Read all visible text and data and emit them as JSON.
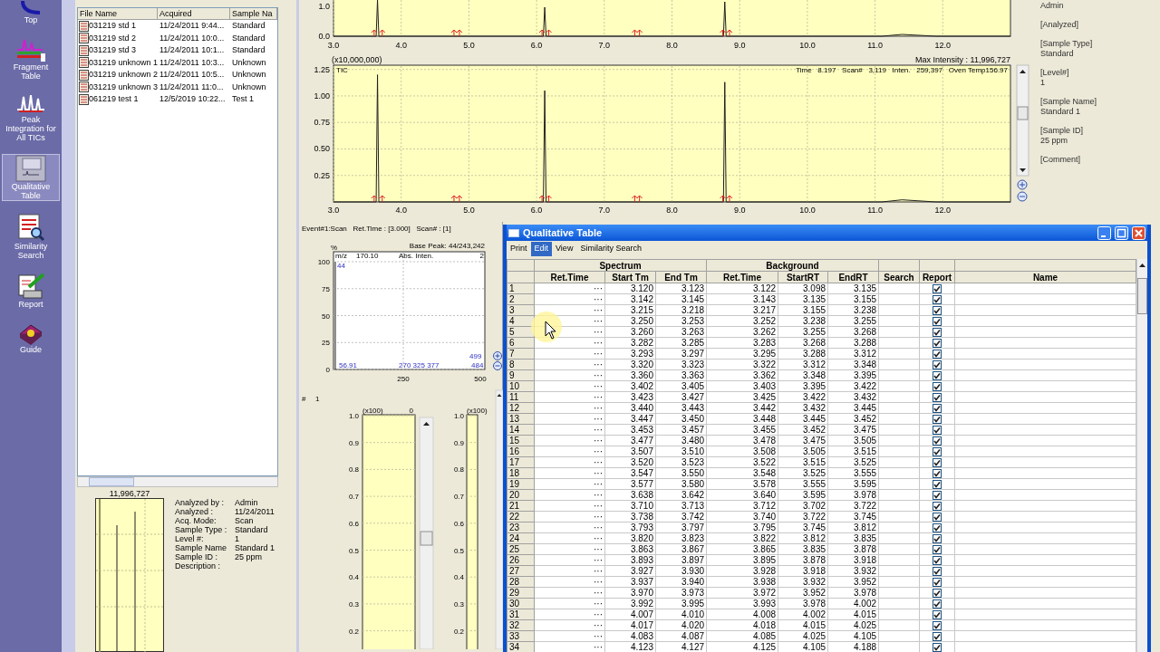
{
  "sidebar": {
    "items": [
      {
        "label": "Top",
        "selected": false
      },
      {
        "label": "Fragment Table",
        "selected": false
      },
      {
        "label": "Peak Integration for All TICs",
        "selected": false
      },
      {
        "label": "Qualitative Table",
        "selected": true
      },
      {
        "label": "Similarity Search",
        "selected": false
      },
      {
        "label": "Report",
        "selected": false
      },
      {
        "label": "Guide",
        "selected": false
      }
    ]
  },
  "file_list": {
    "columns": [
      "File Name",
      "Acquired",
      "Sample Na"
    ],
    "rows": [
      [
        "031219 std 1",
        "11/24/2011 9:44...",
        "Standard"
      ],
      [
        "031219 std 2",
        "11/24/2011 10:0...",
        "Standard"
      ],
      [
        "031219 std 3",
        "11/24/2011 10:1...",
        "Standard"
      ],
      [
        "031219 unknown 1",
        "11/24/2011 10:3...",
        "Unknown"
      ],
      [
        "031219 unknown 2",
        "11/24/2011 10:5...",
        "Unknown"
      ],
      [
        "031219 unknown 3",
        "11/24/2011 11:0...",
        "Unknown"
      ],
      [
        "061219 test 1",
        "12/5/2019 10:22...",
        "Test 1"
      ]
    ]
  },
  "info_panel": {
    "max_intensity": "11,996,727",
    "fields": [
      {
        "label": "Analyzed by :",
        "value": "Admin"
      },
      {
        "label": "Analyzed :",
        "value": "11/24/2011"
      },
      {
        "label": "Acq. Mode:",
        "value": "Scan"
      },
      {
        "label": "Sample Type :",
        "value": "Standard"
      },
      {
        "label": "Level #:",
        "value": "1"
      },
      {
        "label": "Sample Name",
        "value": "Standard 1"
      },
      {
        "label": "Sample ID :",
        "value": "25 ppm"
      },
      {
        "label": "Description :"
      }
    ]
  },
  "chromatogram_top": {
    "y_ticks": [
      "1.0",
      "0.0"
    ],
    "x_ticks": [
      "3.0",
      "4.0",
      "5.0",
      "6.0",
      "7.0",
      "8.0",
      "9.0",
      "10.0",
      "11.0",
      "12.0"
    ]
  },
  "chromatogram_main": {
    "scale": "(x10,000,000)",
    "max_intensity": "Max Intensity : 11,996,727",
    "readout": [
      "Time",
      "8.197",
      "Scan#",
      "3,119",
      "Inten.",
      "259,397",
      "Oven Temp156.97"
    ],
    "chart_data": {
      "type": "line",
      "x": [
        3.0,
        3.63,
        3.65,
        3.67,
        6.1,
        6.12,
        6.14,
        8.76,
        8.78,
        8.8,
        11.1,
        11.4,
        11.9,
        13.0
      ],
      "series": [
        {
          "name": "TIC",
          "color": "#202020",
          "values": [
            0,
            0,
            1.2,
            0,
            0,
            1.05,
            0,
            0,
            1.13,
            0,
            0,
            0.02,
            0,
            0
          ]
        }
      ],
      "xlim": [
        3,
        13
      ],
      "ylim": [
        0,
        1.29
      ],
      "grid": true,
      "xticks": [
        {
          "value": 3,
          "label": "3.0"
        },
        {
          "value": 4,
          "label": "4.0"
        },
        {
          "value": 5,
          "label": "5.0"
        },
        {
          "value": 6,
          "label": "6.0"
        },
        {
          "value": 7,
          "label": "7.0"
        },
        {
          "value": 8,
          "label": "8.0"
        },
        {
          "value": 9,
          "label": "9.0"
        },
        {
          "value": 10,
          "label": "10.0"
        },
        {
          "value": 11,
          "label": "11.0"
        },
        {
          "value": 12,
          "label": "12.0"
        }
      ],
      "yticks": [
        {
          "value": 1.25,
          "label": "1.25"
        },
        {
          "value": 1,
          "label": "1.00"
        },
        {
          "value": 0.75,
          "label": "0.75"
        },
        {
          "value": 0.5,
          "label": "0.50"
        },
        {
          "value": 0.25,
          "label": "0.25"
        }
      ]
    }
  },
  "sample_info": [
    {
      "value": "Admin"
    },
    {
      "heading": "[Analyzed]"
    },
    {
      "heading": "[Sample Type]",
      "value": "Standard"
    },
    {
      "heading": "[Level#]",
      "value": "1"
    },
    {
      "heading": "[Sample Name]",
      "value": "Standard 1"
    },
    {
      "heading": "[Sample ID]",
      "value": "25 ppm"
    },
    {
      "heading": "[Comment]"
    }
  ],
  "spectrum": {
    "header": "Event#1:Scan   Ret.Time : [3.000]   Scan# : [1]",
    "y_unit": "%",
    "base_peak": "Base Peak: 44/243,242",
    "mz_label": "m/z",
    "mz_value": "170.10",
    "inten_label": "Abs. Inten.",
    "corner": "2",
    "y_ticks": [
      "100",
      "75",
      "50",
      "25",
      "0"
    ],
    "x_ticks": [
      "250",
      "500"
    ],
    "peak_labels": [
      "44",
      "56.91",
      "270 325 377",
      "499",
      "484"
    ]
  },
  "bar_panel": {
    "label": "#",
    "index": "1",
    "charts": [
      {
        "scale": "(x100)",
        "value": "0",
        "y_ticks": [
          "1.0",
          "0.9",
          "0.8",
          "0.7",
          "0.6",
          "0.5",
          "0.4",
          "0.3",
          "0.2"
        ]
      },
      {
        "scale": "(x100)",
        "y_ticks": [
          "1.0",
          "0.9",
          "0.8",
          "0.7",
          "0.6",
          "0.5",
          "0.4",
          "0.3",
          "0.2"
        ]
      }
    ]
  },
  "qualitative_table": {
    "title": "Qualitative Table",
    "menu": [
      {
        "label": "Print",
        "selected": false
      },
      {
        "label": "Edit",
        "selected": true
      },
      {
        "label": "View",
        "selected": false
      },
      {
        "label": "Similarity Search",
        "selected": false
      }
    ],
    "groups": [
      {
        "label": "Spectrum",
        "columns": [
          "Ret.Time",
          "Start Tm",
          "End Tm"
        ]
      },
      {
        "label": "Background",
        "columns": [
          "Ret.Time",
          "StartRT",
          "EndRT"
        ]
      }
    ],
    "extra_columns": [
      "Search",
      "Report",
      "Name"
    ],
    "rows": [
      {
        "number": "1",
        "cells": [
          "···",
          "3.120",
          "3.123",
          "3.122",
          "3.098",
          "3.135"
        ],
        "report": true
      },
      {
        "number": "2",
        "cells": [
          "···",
          "3.142",
          "3.145",
          "3.143",
          "3.135",
          "3.155"
        ],
        "report": true
      },
      {
        "number": "3",
        "cells": [
          "···",
          "3.215",
          "3.218",
          "3.217",
          "3.155",
          "3.238"
        ],
        "report": true
      },
      {
        "number": "4",
        "cells": [
          "···",
          "3.250",
          "3.253",
          "3.252",
          "3.238",
          "3.255"
        ],
        "report": true
      },
      {
        "number": "5",
        "cells": [
          "···",
          "3.260",
          "3.263",
          "3.262",
          "3.255",
          "3.268"
        ],
        "report": true
      },
      {
        "number": "6",
        "cells": [
          "···",
          "3.282",
          "3.285",
          "3.283",
          "3.268",
          "3.288"
        ],
        "report": true
      },
      {
        "number": "7",
        "cells": [
          "···",
          "3.293",
          "3.297",
          "3.295",
          "3.288",
          "3.312"
        ],
        "report": true
      },
      {
        "number": "8",
        "cells": [
          "···",
          "3.320",
          "3.323",
          "3.322",
          "3.312",
          "3.348"
        ],
        "report": true
      },
      {
        "number": "9",
        "cells": [
          "···",
          "3.360",
          "3.363",
          "3.362",
          "3.348",
          "3.395"
        ],
        "report": true
      },
      {
        "number": "10",
        "cells": [
          "···",
          "3.402",
          "3.405",
          "3.403",
          "3.395",
          "3.422"
        ],
        "report": true
      },
      {
        "number": "11",
        "cells": [
          "···",
          "3.423",
          "3.427",
          "3.425",
          "3.422",
          "3.432"
        ],
        "report": true
      },
      {
        "number": "12",
        "cells": [
          "···",
          "3.440",
          "3.443",
          "3.442",
          "3.432",
          "3.445"
        ],
        "report": true
      },
      {
        "number": "13",
        "cells": [
          "···",
          "3.447",
          "3.450",
          "3.448",
          "3.445",
          "3.452"
        ],
        "report": true
      },
      {
        "number": "14",
        "cells": [
          "···",
          "3.453",
          "3.457",
          "3.455",
          "3.452",
          "3.475"
        ],
        "report": true
      },
      {
        "number": "15",
        "cells": [
          "···",
          "3.477",
          "3.480",
          "3.478",
          "3.475",
          "3.505"
        ],
        "report": true
      },
      {
        "number": "16",
        "cells": [
          "···",
          "3.507",
          "3.510",
          "3.508",
          "3.505",
          "3.515"
        ],
        "report": true
      },
      {
        "number": "17",
        "cells": [
          "···",
          "3.520",
          "3.523",
          "3.522",
          "3.515",
          "3.525"
        ],
        "report": true
      },
      {
        "number": "18",
        "cells": [
          "···",
          "3.547",
          "3.550",
          "3.548",
          "3.525",
          "3.555"
        ],
        "report": true
      },
      {
        "number": "19",
        "cells": [
          "···",
          "3.577",
          "3.580",
          "3.578",
          "3.555",
          "3.595"
        ],
        "report": true
      },
      {
        "number": "20",
        "cells": [
          "···",
          "3.638",
          "3.642",
          "3.640",
          "3.595",
          "3.978"
        ],
        "report": true
      },
      {
        "number": "21",
        "cells": [
          "···",
          "3.710",
          "3.713",
          "3.712",
          "3.702",
          "3.722"
        ],
        "report": true
      },
      {
        "number": "22",
        "cells": [
          "···",
          "3.738",
          "3.742",
          "3.740",
          "3.722",
          "3.745"
        ],
        "report": true
      },
      {
        "number": "23",
        "cells": [
          "···",
          "3.793",
          "3.797",
          "3.795",
          "3.745",
          "3.812"
        ],
        "report": true
      },
      {
        "number": "24",
        "cells": [
          "···",
          "3.820",
          "3.823",
          "3.822",
          "3.812",
          "3.835"
        ],
        "report": true
      },
      {
        "number": "25",
        "cells": [
          "···",
          "3.863",
          "3.867",
          "3.865",
          "3.835",
          "3.878"
        ],
        "report": true
      },
      {
        "number": "26",
        "cells": [
          "···",
          "3.893",
          "3.897",
          "3.895",
          "3.878",
          "3.918"
        ],
        "report": true
      },
      {
        "number": "27",
        "cells": [
          "···",
          "3.927",
          "3.930",
          "3.928",
          "3.918",
          "3.932"
        ],
        "report": true
      },
      {
        "number": "28",
        "cells": [
          "···",
          "3.937",
          "3.940",
          "3.938",
          "3.932",
          "3.952"
        ],
        "report": true
      },
      {
        "number": "29",
        "cells": [
          "···",
          "3.970",
          "3.973",
          "3.972",
          "3.952",
          "3.978"
        ],
        "report": true
      },
      {
        "number": "30",
        "cells": [
          "···",
          "3.992",
          "3.995",
          "3.993",
          "3.978",
          "4.002"
        ],
        "report": true
      },
      {
        "number": "31",
        "cells": [
          "···",
          "4.007",
          "4.010",
          "4.008",
          "4.002",
          "4.015"
        ],
        "report": true
      },
      {
        "number": "32",
        "cells": [
          "···",
          "4.017",
          "4.020",
          "4.018",
          "4.015",
          "4.025"
        ],
        "report": true
      },
      {
        "number": "33",
        "cells": [
          "···",
          "4.083",
          "4.087",
          "4.085",
          "4.025",
          "4.105"
        ],
        "report": true
      },
      {
        "number": "34",
        "cells": [
          "···",
          "4.123",
          "4.127",
          "4.125",
          "4.105",
          "4.188"
        ],
        "report": true
      }
    ]
  }
}
